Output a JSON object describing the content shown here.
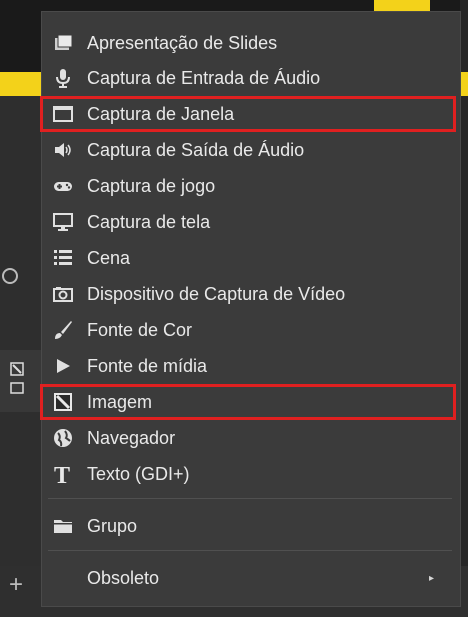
{
  "background": {
    "add_glyph": "+"
  },
  "menu": {
    "items": [
      {
        "label": "Apresentação de Slides",
        "icon": "slideshow-icon"
      },
      {
        "label": "Captura de Entrada de Áudio",
        "icon": "microphone-icon"
      },
      {
        "label": "Captura de Janela",
        "icon": "window-icon",
        "highlighted": true
      },
      {
        "label": "Captura de Saída de Áudio",
        "icon": "speaker-icon"
      },
      {
        "label": "Captura de jogo",
        "icon": "gamepad-icon"
      },
      {
        "label": "Captura de tela",
        "icon": "monitor-icon"
      },
      {
        "label": "Cena",
        "icon": "list-icon"
      },
      {
        "label": "Dispositivo de Captura de Vídeo",
        "icon": "camera-icon"
      },
      {
        "label": "Fonte de Cor",
        "icon": "brush-icon"
      },
      {
        "label": "Fonte de mídia",
        "icon": "play-icon"
      },
      {
        "label": "Imagem",
        "icon": "image-icon",
        "highlighted": true
      },
      {
        "label": "Navegador",
        "icon": "globe-icon"
      },
      {
        "label": "Texto (GDI+)",
        "icon": "text-icon"
      },
      {
        "label": "Grupo",
        "icon": "folder-icon"
      },
      {
        "label": "Obsoleto",
        "icon": "",
        "submenu_arrow": "▸"
      }
    ]
  },
  "colors": {
    "highlight": "#e02020",
    "menu_bg": "#3b3b3b",
    "accent_yellow": "#f3d21a"
  }
}
